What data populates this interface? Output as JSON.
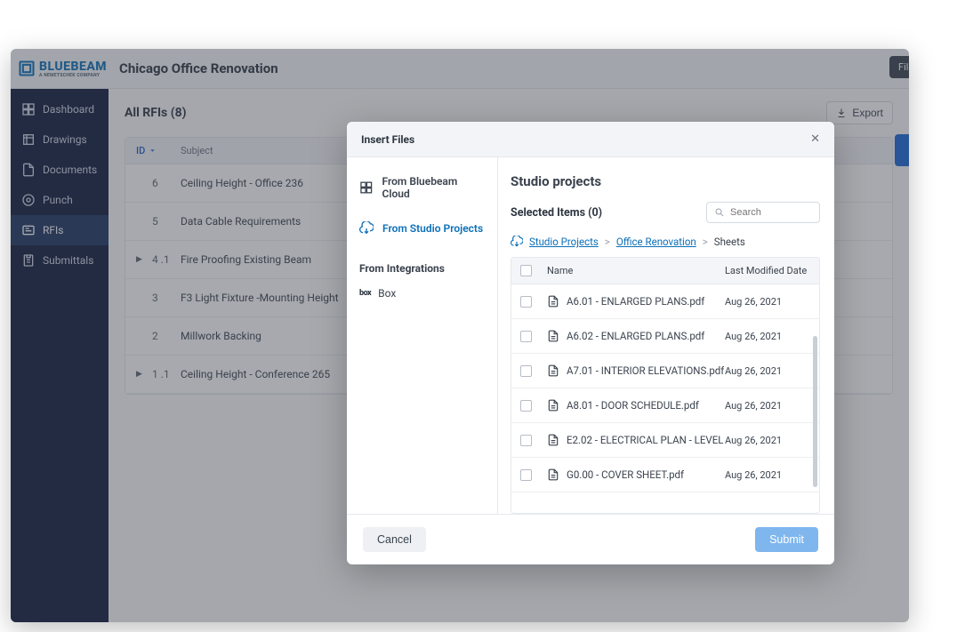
{
  "brand": "BLUEBEAM",
  "brand_sub": "A NEMETSCHEK COMPANY",
  "project_title": "Chicago Office Renovation",
  "file_tab": "File",
  "sidebar": {
    "items": [
      {
        "label": "Dashboard"
      },
      {
        "label": "Drawings"
      },
      {
        "label": "Documents"
      },
      {
        "label": "Punch"
      },
      {
        "label": "RFIs"
      },
      {
        "label": "Submittals"
      }
    ]
  },
  "main": {
    "title": "All RFIs (8)",
    "export_label": "Export",
    "columns": {
      "id": "ID",
      "subject": "Subject"
    },
    "rows": [
      {
        "expand": "",
        "id": "6",
        "subject": "Ceiling Height - Office 236"
      },
      {
        "expand": "",
        "id": "5",
        "subject": "Data Cable Requirements"
      },
      {
        "expand": "▶",
        "id": "4 .1",
        "subject": "Fire Proofing Existing Beam"
      },
      {
        "expand": "",
        "id": "3",
        "subject": "F3 Light Fixture -Mounting Height"
      },
      {
        "expand": "",
        "id": "2",
        "subject": "Millwork Backing"
      },
      {
        "expand": "▶",
        "id": "1 .1",
        "subject": "Ceiling Height - Conference 265"
      }
    ]
  },
  "modal": {
    "title": "Insert Files",
    "sources": {
      "cloud": "From Bluebeam Cloud",
      "studio": "From Studio Projects",
      "integrations_header": "From Integrations",
      "box": "Box"
    },
    "panel_title": "Studio projects",
    "selected_label": "Selected Items (0)",
    "search_placeholder": "Search",
    "breadcrumb": {
      "root": "Studio Projects",
      "folder": "Office Renovation",
      "current": "Sheets"
    },
    "columns": {
      "name": "Name",
      "date": "Last Modified Date"
    },
    "files": [
      {
        "name": "A6.01 - ENLARGED PLANS.pdf",
        "date": "Aug 26, 2021"
      },
      {
        "name": "A6.02 - ENLARGED PLANS.pdf",
        "date": "Aug 26, 2021"
      },
      {
        "name": "A7.01 - INTERIOR ELEVATIONS.pdf",
        "date": "Aug 26, 2021"
      },
      {
        "name": "A8.01 - DOOR SCHEDULE.pdf",
        "date": "Aug 26, 2021"
      },
      {
        "name": "E2.02 - ELECTRICAL PLAN - LEVEL",
        "date": "Aug 26, 2021"
      },
      {
        "name": "G0.00 - COVER SHEET.pdf",
        "date": "Aug 26, 2021"
      }
    ],
    "cancel": "Cancel",
    "submit": "Submit"
  }
}
